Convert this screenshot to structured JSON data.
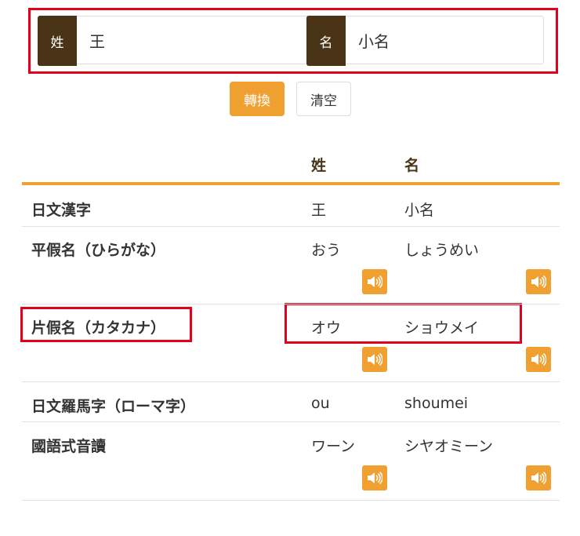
{
  "form": {
    "surname_label": "姓",
    "surname_value": "王",
    "given_label": "名",
    "given_value": "小名",
    "convert_button": "轉換",
    "clear_button": "清空"
  },
  "table": {
    "col_surname": "姓",
    "col_given": "名",
    "rows": [
      {
        "label": "日文漢字",
        "surname": "王",
        "given": "小名"
      },
      {
        "label": "平假名（ひらがな）",
        "surname": "おう",
        "given": "しょうめい"
      },
      {
        "label": "片假名（カタカナ）",
        "surname": "オウ",
        "given": "ショウメイ"
      },
      {
        "label": "日文羅馬字（ローマ字）",
        "surname": "ou",
        "given": "shoumei"
      },
      {
        "label": "國語式音讀",
        "surname": "ワーン",
        "given": "シヤオミーン"
      }
    ]
  },
  "icons": {
    "speaker": "volume-up-icon"
  },
  "colors": {
    "accent": "#f0a030",
    "addon": "#4a3418",
    "highlight": "#e3001b"
  }
}
